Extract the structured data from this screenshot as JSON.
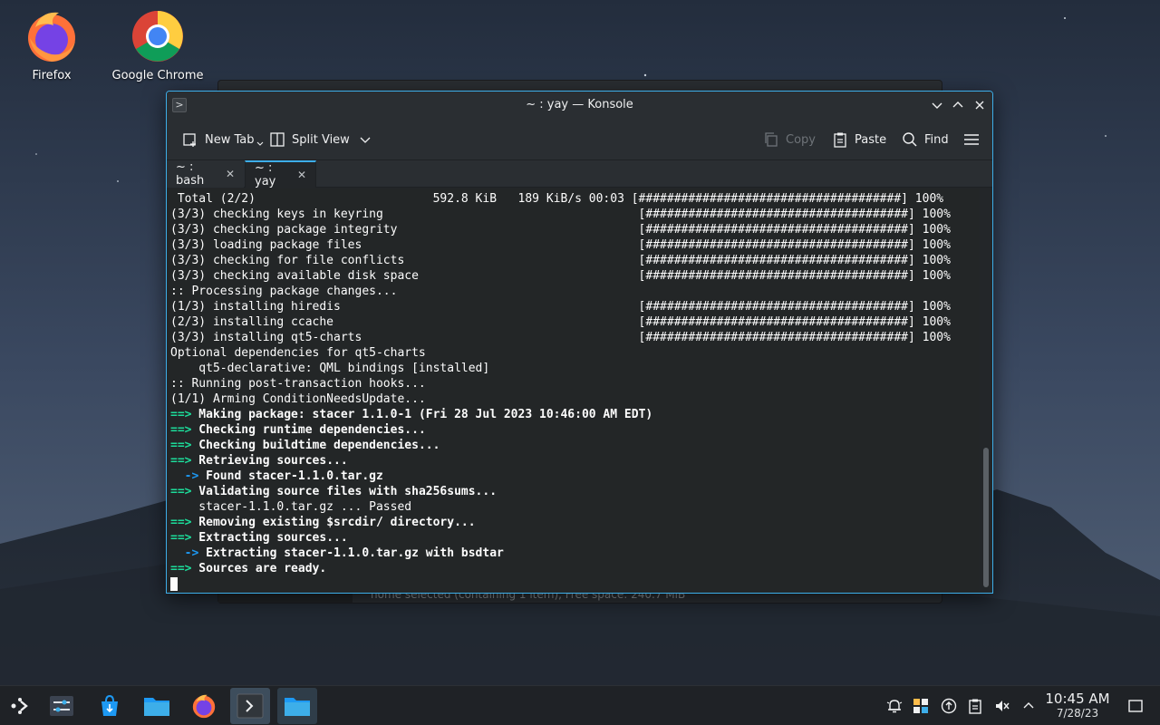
{
  "desktop": {
    "icons": [
      {
        "label": "Firefox"
      },
      {
        "label": "Google Chrome"
      }
    ]
  },
  "background_window": {
    "status_text": "home  selected (containing 1 item), Free space: 240.7 MiB"
  },
  "konsole": {
    "title": "~ : yay — Konsole",
    "toolbar": {
      "new_tab": "New Tab",
      "split_view": "Split View",
      "copy": "Copy",
      "paste": "Paste",
      "find": "Find"
    },
    "tabs": [
      {
        "label": "~ : bash",
        "active": false
      },
      {
        "label": "~ : yay",
        "active": true
      }
    ],
    "terminal_lines": [
      {
        "prefix": "",
        "text": " Total (2/2)                         592.8 KiB   189 KiB/s 00:03 [#####################################] 100%",
        "bold": false
      },
      {
        "prefix": "",
        "text": "(3/3) checking keys in keyring                                    [#####################################] 100%",
        "bold": false
      },
      {
        "prefix": "",
        "text": "(3/3) checking package integrity                                  [#####################################] 100%",
        "bold": false
      },
      {
        "prefix": "",
        "text": "(3/3) loading package files                                       [#####################################] 100%",
        "bold": false
      },
      {
        "prefix": "",
        "text": "(3/3) checking for file conflicts                                 [#####################################] 100%",
        "bold": false
      },
      {
        "prefix": "",
        "text": "(3/3) checking available disk space                               [#####################################] 100%",
        "bold": false
      },
      {
        "prefix": "",
        "text": ":: Processing package changes...",
        "bold": false
      },
      {
        "prefix": "",
        "text": "(1/3) installing hiredis                                          [#####################################] 100%",
        "bold": false
      },
      {
        "prefix": "",
        "text": "(2/3) installing ccache                                           [#####################################] 100%",
        "bold": false
      },
      {
        "prefix": "",
        "text": "(3/3) installing qt5-charts                                       [#####################################] 100%",
        "bold": false
      },
      {
        "prefix": "",
        "text": "Optional dependencies for qt5-charts",
        "bold": false
      },
      {
        "prefix": "",
        "text": "    qt5-declarative: QML bindings [installed]",
        "bold": false
      },
      {
        "prefix": "",
        "text": ":: Running post-transaction hooks...",
        "bold": false
      },
      {
        "prefix": "",
        "text": "(1/1) Arming ConditionNeedsUpdate...",
        "bold": false
      },
      {
        "prefix": "==>",
        "text": " Making package: stacer 1.1.0-1 (Fri 28 Jul 2023 10:46:00 AM EDT)",
        "bold": true
      },
      {
        "prefix": "==>",
        "text": " Checking runtime dependencies...",
        "bold": true
      },
      {
        "prefix": "==>",
        "text": " Checking buildtime dependencies...",
        "bold": true
      },
      {
        "prefix": "==>",
        "text": " Retrieving sources...",
        "bold": true
      },
      {
        "prefix": "  ->",
        "text": " Found stacer-1.1.0.tar.gz",
        "bold": true
      },
      {
        "prefix": "==>",
        "text": " Validating source files with sha256sums...",
        "bold": true
      },
      {
        "prefix": "",
        "text": "    stacer-1.1.0.tar.gz ... Passed",
        "bold": false
      },
      {
        "prefix": "==>",
        "text": " Removing existing $srcdir/ directory...",
        "bold": true
      },
      {
        "prefix": "==>",
        "text": " Extracting sources...",
        "bold": true
      },
      {
        "prefix": "  ->",
        "text": " Extracting stacer-1.1.0.tar.gz with bsdtar",
        "bold": true
      },
      {
        "prefix": "==>",
        "text": " Sources are ready.",
        "bold": true
      }
    ]
  },
  "taskbar": {
    "clock_time": "10:45 AM",
    "clock_date": "7/28/23"
  },
  "colors": {
    "accent": "#3daee9",
    "terminal_green": "#1cdc9a",
    "terminal_blue": "#1d99f3"
  }
}
